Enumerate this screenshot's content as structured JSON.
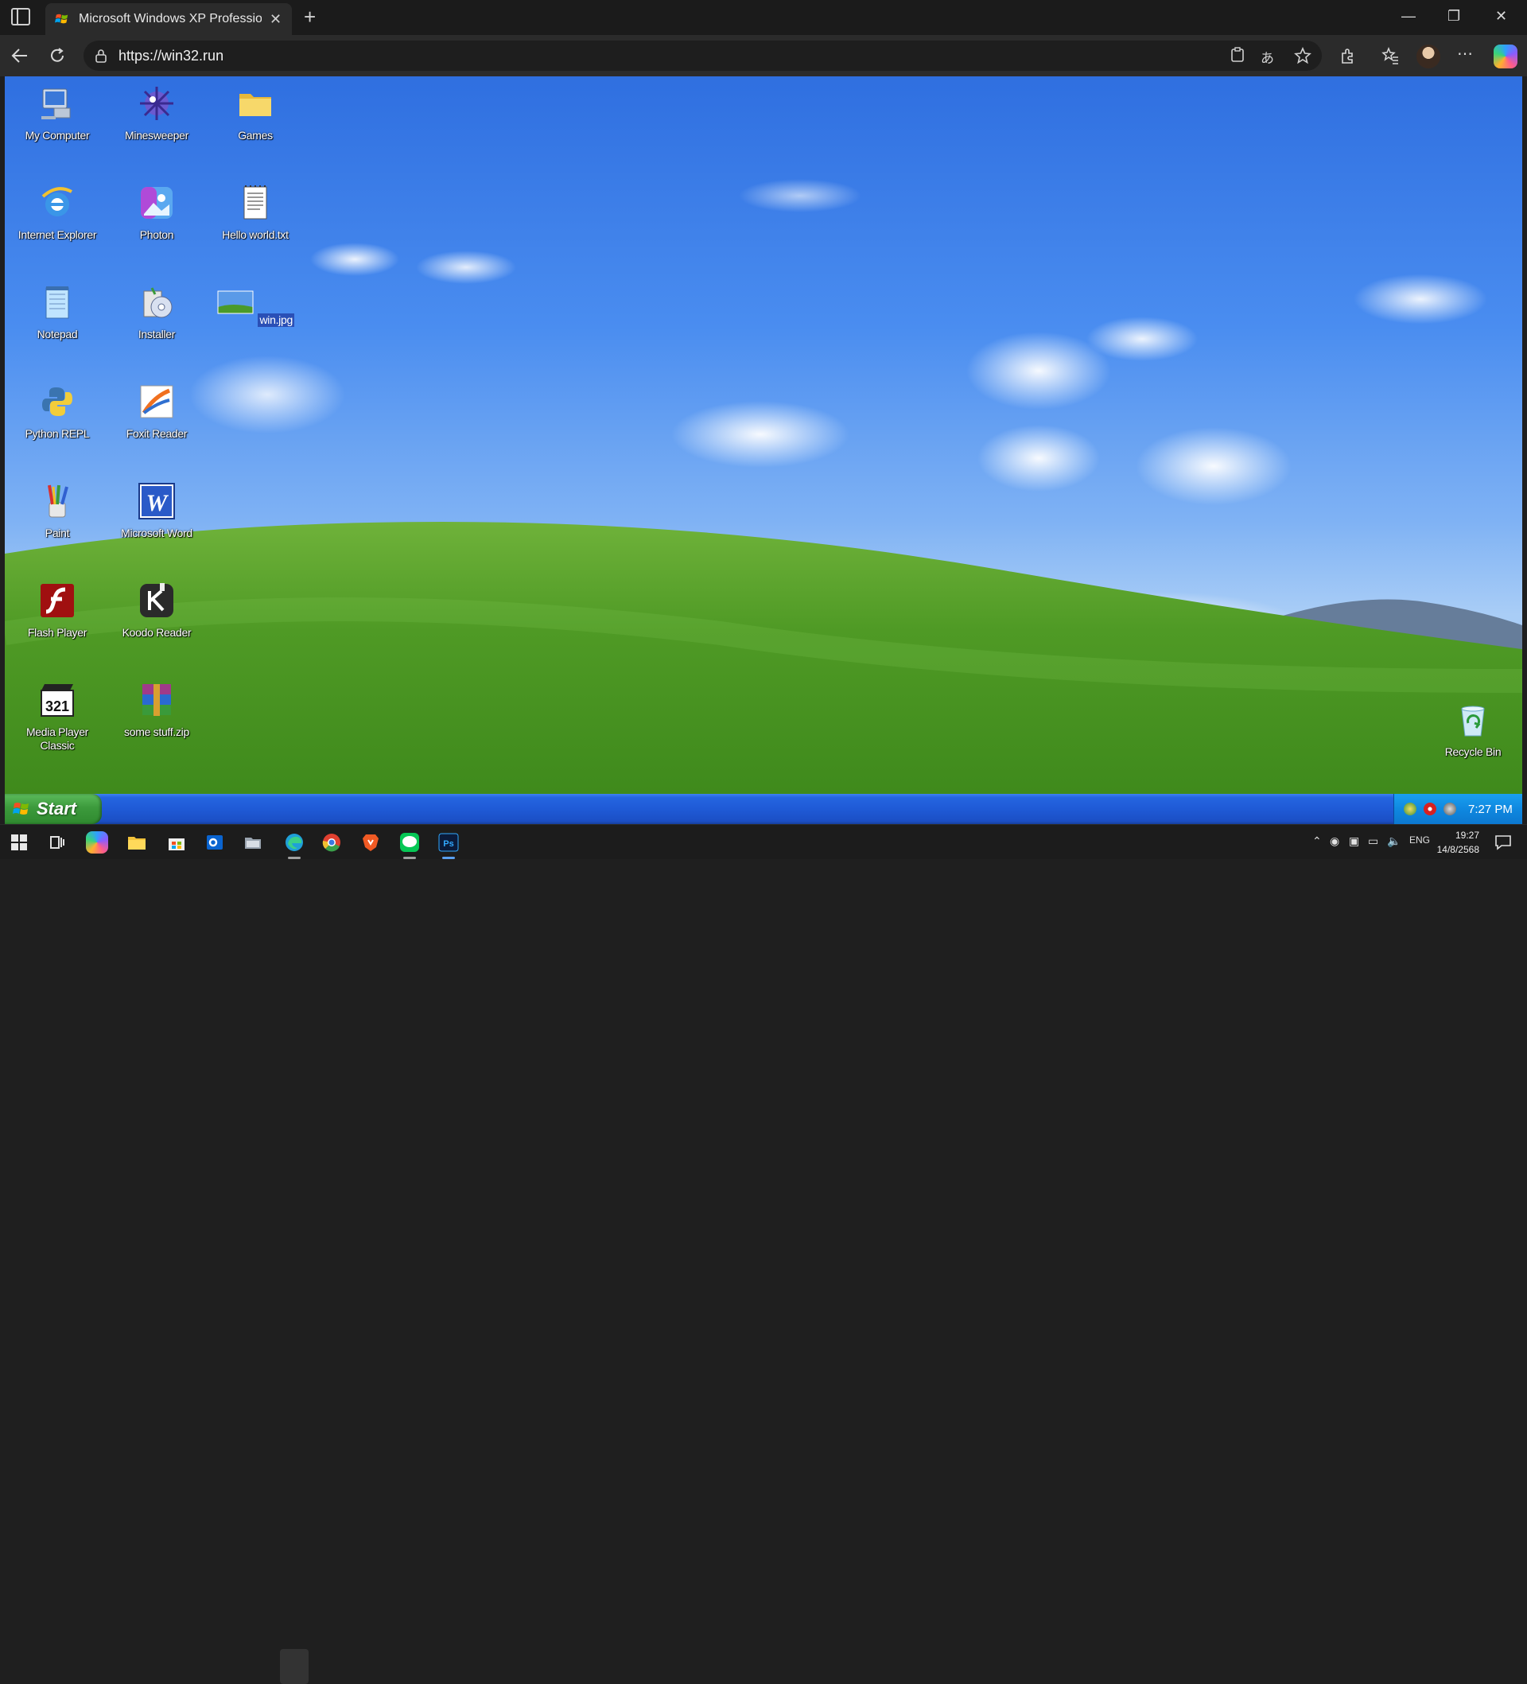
{
  "browser": {
    "tab_title": "Microsoft Windows XP Profession",
    "new_tab_symbol": "+",
    "close_symbol": "✕",
    "url": "https://win32.run",
    "window_controls": [
      "—",
      "❐",
      "✕"
    ]
  },
  "desktop": {
    "icons": [
      {
        "label": "My Computer",
        "icon": "my-computer-icon"
      },
      {
        "label": "Minesweeper",
        "icon": "minesweeper-icon"
      },
      {
        "label": "Games",
        "icon": "folder-icon"
      },
      {
        "label": "Internet Explorer",
        "icon": "internet-explorer-icon"
      },
      {
        "label": "Photon",
        "icon": "photon-icon"
      },
      {
        "label": "Hello world.txt",
        "icon": "text-file-icon"
      },
      {
        "label": "Notepad",
        "icon": "notepad-icon"
      },
      {
        "label": "Installer",
        "icon": "installer-icon"
      },
      {
        "label": "win.jpg",
        "icon": "image-file-icon",
        "selected": true
      },
      {
        "label": "Python REPL",
        "icon": "python-icon"
      },
      {
        "label": "Foxit Reader",
        "icon": "foxit-reader-icon"
      },
      {
        "label": "Paint",
        "icon": "paint-icon"
      },
      {
        "label": "Microsoft Word",
        "icon": "word-icon"
      },
      {
        "label": "Flash Player",
        "icon": "flash-player-icon"
      },
      {
        "label": "Koodo Reader",
        "icon": "koodo-reader-icon"
      },
      {
        "label": "Media Player Classic",
        "icon": "media-player-icon"
      },
      {
        "label": "some stuff.zip",
        "icon": "zip-file-icon"
      },
      {
        "label": "Recycle Bin",
        "icon": "recycle-bin-icon"
      }
    ]
  },
  "xp_taskbar": {
    "start_label": "Start",
    "clock": "7:27 PM"
  },
  "windows_taskbar": {
    "language": "ENG",
    "time": "19:27",
    "date": "14/8/2568"
  },
  "colors": {
    "xp_blue": "#1f5ad6",
    "start_green": "#3c9a3c",
    "tray_blue": "#0f88e0"
  }
}
